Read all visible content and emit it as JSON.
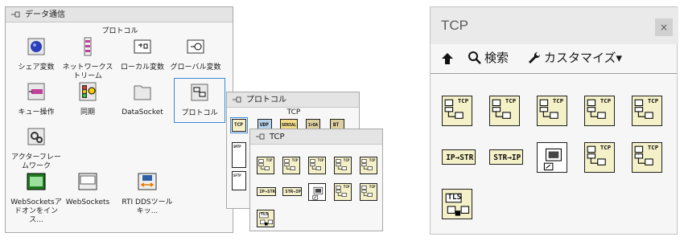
{
  "data_comm_palette": {
    "title": "データ通信",
    "header": "プロトコル",
    "items": [
      {
        "label": "シェア変数"
      },
      {
        "label": "ネットワークストリーム"
      },
      {
        "label": "ローカル変数"
      },
      {
        "label": "グローバル変数"
      },
      {
        "label": "キュー操作"
      },
      {
        "label": "同期"
      },
      {
        "label": "DataSocket"
      },
      {
        "label": "プロトコル"
      },
      {
        "label": "アクターフレームワーク"
      },
      {
        "label": "WebSocketsアドオンをインス..."
      },
      {
        "label": "WebSockets"
      },
      {
        "label": "RTI DDSツールキッ..."
      }
    ]
  },
  "protocol_palette": {
    "title": "プロトコル",
    "header": "TCP",
    "icons": [
      "TCP",
      "UDP",
      "SERIAL",
      "IrDA",
      "BT"
    ],
    "side_icons": [
      "SMTP",
      "SFTP"
    ]
  },
  "small_tcp_palette": {
    "title": "TCP"
  },
  "tcp_palette": {
    "title": "TCP",
    "close": "×",
    "toolbar": {
      "up_label": "",
      "search_label": "検索",
      "customize_label": "カスタマイズ▾"
    },
    "icons": [
      {
        "name": "tcp-listen",
        "text": "TCP"
      },
      {
        "name": "tcp-open-connection",
        "text": "TCP"
      },
      {
        "name": "tcp-read",
        "text": "TCP"
      },
      {
        "name": "tcp-write",
        "text": "TCP"
      },
      {
        "name": "tcp-close-connection",
        "text": "TCP"
      },
      {
        "name": "ip-to-string",
        "text": "IP→STR"
      },
      {
        "name": "string-to-ip",
        "text": "STR→IP"
      },
      {
        "name": "tcp-vi-reference",
        "text": ""
      },
      {
        "name": "tcp-create-listener",
        "text": "TCP"
      },
      {
        "name": "tcp-wait-on-listener",
        "text": "TCP"
      },
      {
        "name": "tls",
        "text": "TLS"
      }
    ]
  }
}
